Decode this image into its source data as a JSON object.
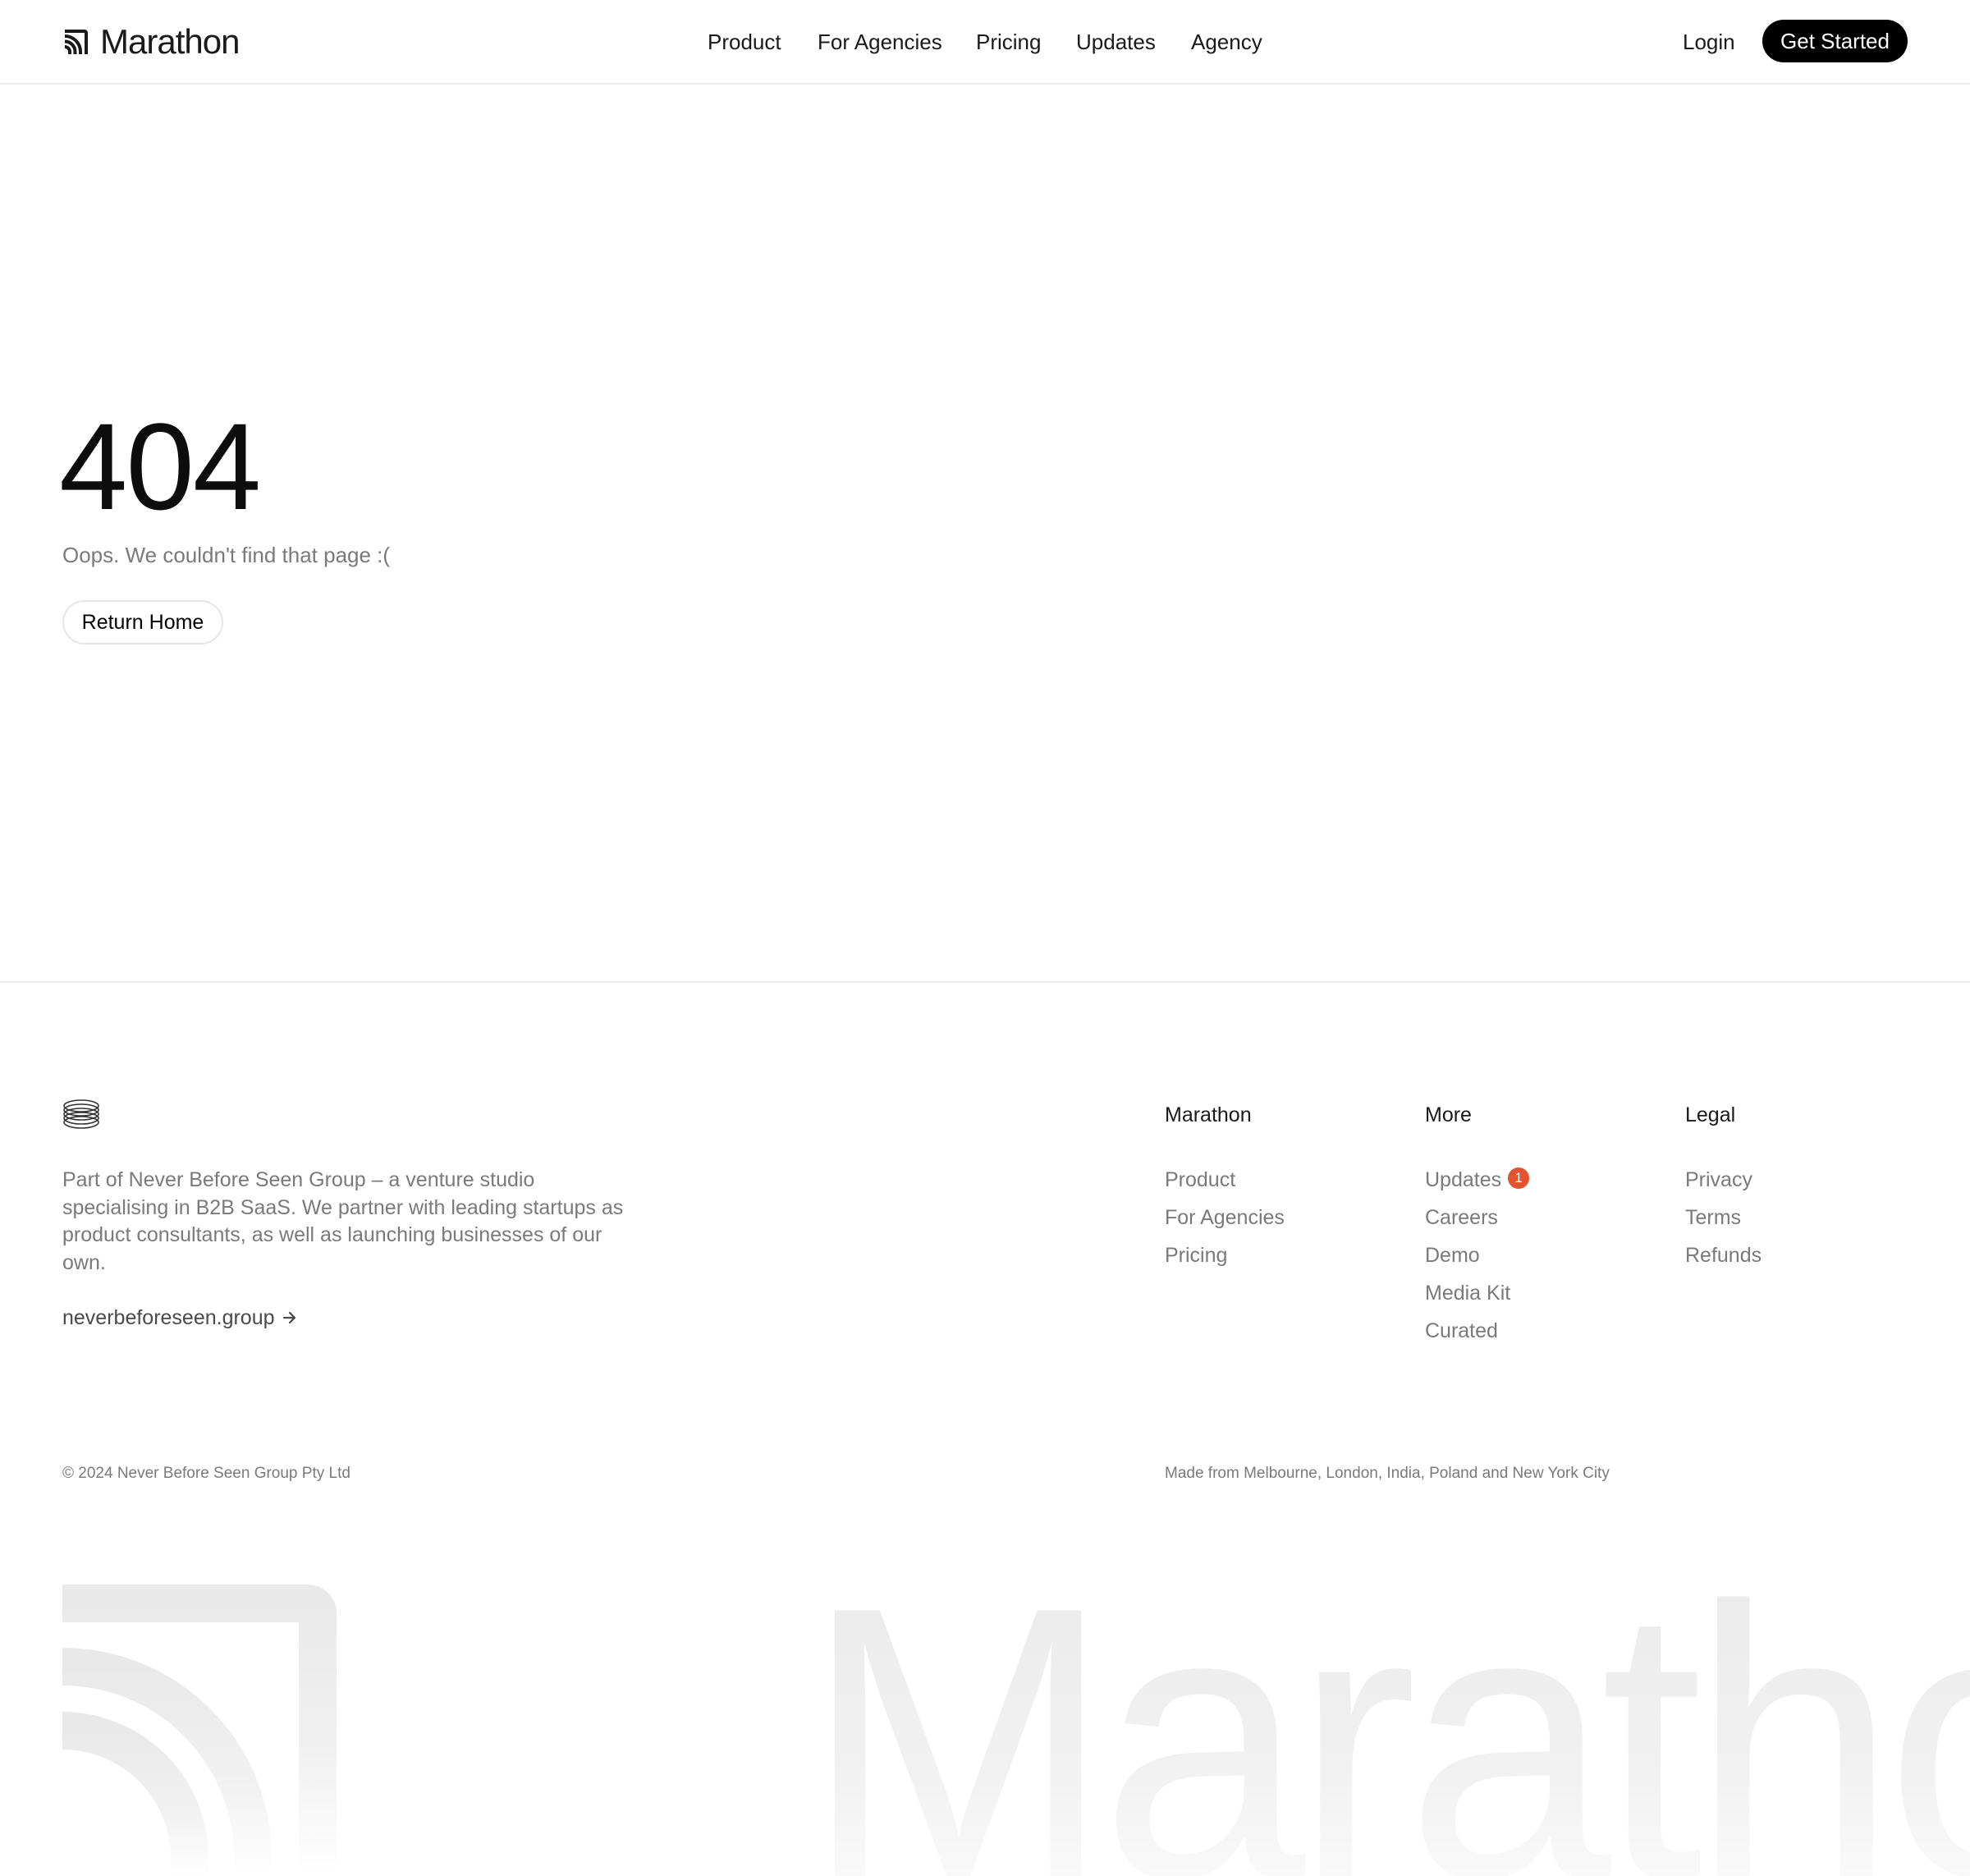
{
  "header": {
    "brand": "Marathon",
    "nav": [
      "Product",
      "For Agencies",
      "Pricing",
      "Updates",
      "Agency"
    ],
    "login": "Login",
    "cta": "Get Started"
  },
  "main": {
    "error_code": "404",
    "message": "Oops. We couldn't find that page :(",
    "return_home": "Return Home"
  },
  "footer": {
    "about": "Part of Never Before Seen Group – a venture studio specialising in B2B SaaS. We partner with leading startups as product consultants, as well as launching businesses of our own.",
    "group_link": "neverbeforeseen.group",
    "columns": [
      {
        "heading": "Marathon",
        "links": [
          "Product",
          "For Agencies",
          "Pricing"
        ]
      },
      {
        "heading": "More",
        "links": [
          "Updates",
          "Careers",
          "Demo",
          "Media Kit",
          "Curated"
        ],
        "badge": "1"
      },
      {
        "heading": "Legal",
        "links": [
          "Privacy",
          "Terms",
          "Refunds"
        ]
      }
    ],
    "copyright": "© 2024 Never Before Seen Group Pty Ltd",
    "made_from": "Made from Melbourne, London, India, Poland and New York City",
    "watermark": "Marathon"
  },
  "colors": {
    "accent_badge": "#e2532e",
    "cta_background": "#000000",
    "muted_text": "#7a7a7a"
  },
  "icons": {
    "brand": "marathon-logo-icon",
    "group": "stacked-rings-icon",
    "link": "arrow-right-icon"
  }
}
